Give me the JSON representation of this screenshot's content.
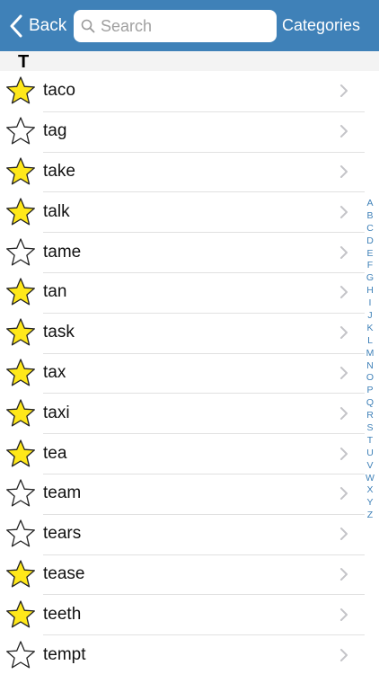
{
  "navbar": {
    "back_label": "Back",
    "search_placeholder": "Search",
    "categories_label": "Categories",
    "bar_color": "#3f81b8"
  },
  "section": {
    "letter": "T"
  },
  "words": [
    {
      "word": "taco",
      "starred": true
    },
    {
      "word": "tag",
      "starred": false
    },
    {
      "word": "take",
      "starred": true
    },
    {
      "word": "talk",
      "starred": true
    },
    {
      "word": "tame",
      "starred": false
    },
    {
      "word": "tan",
      "starred": true
    },
    {
      "word": "task",
      "starred": true
    },
    {
      "word": "tax",
      "starred": true
    },
    {
      "word": "taxi",
      "starred": true
    },
    {
      "word": "tea",
      "starred": true
    },
    {
      "word": "team",
      "starred": false
    },
    {
      "word": "tears",
      "starred": false
    },
    {
      "word": "tease",
      "starred": true
    },
    {
      "word": "teeth",
      "starred": true
    },
    {
      "word": "tempt",
      "starred": false
    }
  ],
  "index_letters": [
    "A",
    "B",
    "C",
    "D",
    "E",
    "F",
    "G",
    "H",
    "I",
    "J",
    "K",
    "L",
    "M",
    "N",
    "O",
    "P",
    "Q",
    "R",
    "S",
    "T",
    "U",
    "V",
    "W",
    "X",
    "Y",
    "Z"
  ],
  "colors": {
    "star_fill": "#ffe81a",
    "star_stroke": "#222222",
    "index": "#3f81b8"
  }
}
